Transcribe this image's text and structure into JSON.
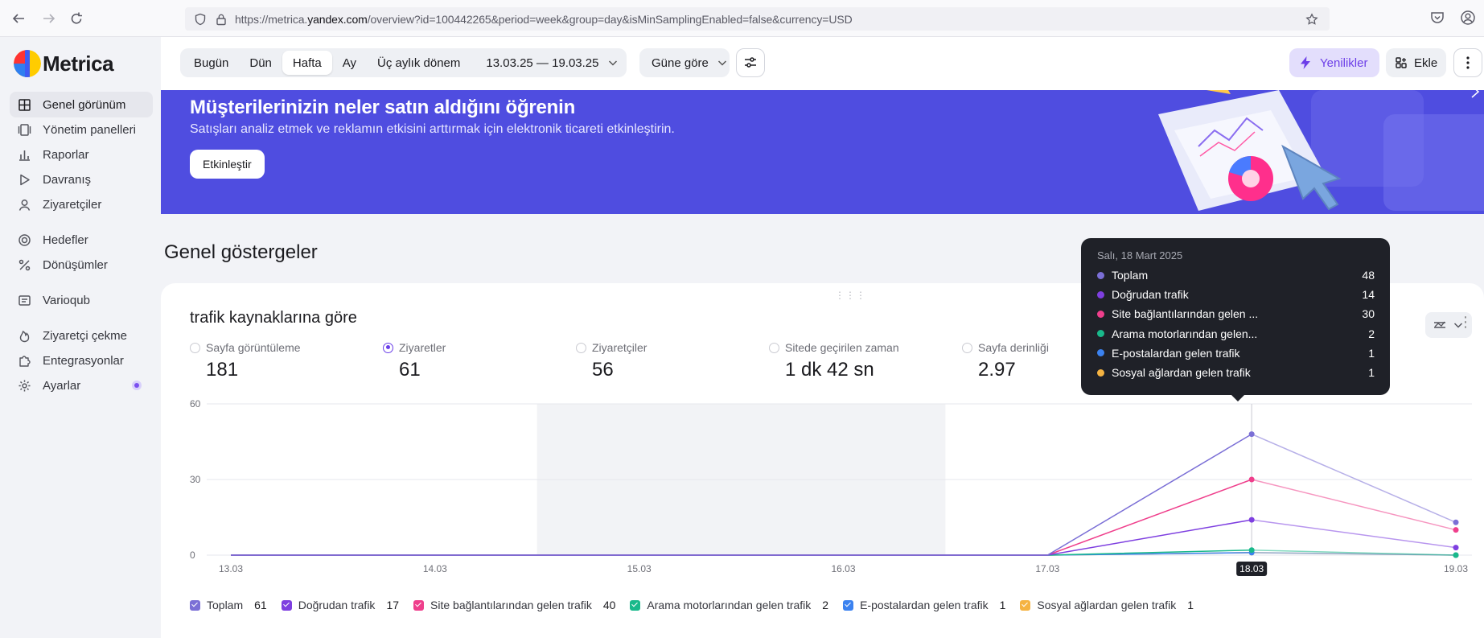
{
  "browser": {
    "url_prefix": "https://metrica.",
    "url_domain": "yandex.com",
    "url_suffix": "/overview?id=100442265&period=week&group=day&isMinSamplingEnabled=false&currency=USD"
  },
  "app": {
    "logo_text": "Metrica"
  },
  "sidebar": {
    "items": [
      {
        "label": "Genel görünüm",
        "icon": "grid-icon"
      },
      {
        "label": "Yönetim panelleri",
        "icon": "panels-icon"
      },
      {
        "label": "Raporlar",
        "icon": "bar-chart-icon"
      },
      {
        "label": "Davranış",
        "icon": "play-icon"
      },
      {
        "label": "Ziyaretçiler",
        "icon": "user-icon"
      },
      {
        "label": "Hedefler",
        "icon": "target-icon"
      },
      {
        "label": "Dönüşümler",
        "icon": "percent-icon"
      },
      {
        "label": "Varioqub",
        "icon": "flask-icon"
      },
      {
        "label": "Ziyaretçi çekme",
        "icon": "flame-icon"
      },
      {
        "label": "Entegrasyonlar",
        "icon": "puzzle-icon"
      },
      {
        "label": "Ayarlar",
        "icon": "gear-icon"
      }
    ]
  },
  "toolbar": {
    "periods": [
      "Bugün",
      "Dün",
      "Hafta",
      "Ay",
      "Üç aylık dönem"
    ],
    "active_period": "Hafta",
    "date_range": "13.03.25 — 19.03.25",
    "grouping": "Güne göre",
    "news_label": "Yenilikler",
    "add_label": "Ekle"
  },
  "banner": {
    "title": "Müşterilerinizin neler satın aldığını öğrenin",
    "subtitle": "Satışları analiz etmek ve reklamın etkisini arttırmak için elektronik ticareti etkinleştirin.",
    "button": "Etkinleştir"
  },
  "section": {
    "title": "Genel göstergeler"
  },
  "card": {
    "title": "trafik kaynaklarına göre",
    "metrics": [
      {
        "label": "Sayfa görüntüleme",
        "value": "181",
        "selected": false
      },
      {
        "label": "Ziyaretler",
        "value": "61",
        "selected": true
      },
      {
        "label": "Ziyaretçiler",
        "value": "56",
        "selected": false
      },
      {
        "label": "Sitede geçirilen zaman",
        "value": "1 dk 42 sn",
        "selected": false
      },
      {
        "label": "Sayfa derinliği",
        "value": "2.97",
        "selected": false
      }
    ],
    "legend": [
      {
        "name": "Toplam",
        "value": "61",
        "color": "#7b6fd6"
      },
      {
        "name": "Doğrudan trafik",
        "value": "17",
        "color": "#7e3fe0"
      },
      {
        "name": "Site bağlantılarından gelen trafik",
        "value": "40",
        "color": "#ef3f8c"
      },
      {
        "name": "Arama motorlarından gelen trafik",
        "value": "2",
        "color": "#19b98b"
      },
      {
        "name": "E-postalardan gelen trafik",
        "value": "1",
        "color": "#3b82f0"
      },
      {
        "name": "Sosyal ağlardan gelen trafik",
        "value": "1",
        "color": "#f5b342"
      }
    ]
  },
  "tooltip": {
    "date": "Salı, 18 Mart 2025",
    "rows": [
      {
        "name": "Toplam",
        "value": "48",
        "color": "#7b6fd6"
      },
      {
        "name": "Doğrudan trafik",
        "value": "14",
        "color": "#7e3fe0"
      },
      {
        "name": "Site bağlantılarından gelen ...",
        "value": "30",
        "color": "#ef3f8c"
      },
      {
        "name": "Arama motorlarından gelen...",
        "value": "2",
        "color": "#19b98b"
      },
      {
        "name": "E-postalardan gelen trafik",
        "value": "1",
        "color": "#3b82f0"
      },
      {
        "name": "Sosyal ağlardan gelen trafik",
        "value": "1",
        "color": "#f5b342"
      }
    ]
  },
  "chart_data": {
    "type": "line",
    "x": [
      "13.03",
      "14.03",
      "15.03",
      "16.03",
      "17.03",
      "18.03",
      "19.03"
    ],
    "ylim": [
      0,
      60
    ],
    "yticks": [
      "0",
      "30",
      "60"
    ],
    "highlighted_x": "18.03",
    "series": [
      {
        "name": "Toplam",
        "color": "#7b6fd6",
        "values": [
          0,
          0,
          0,
          0,
          0,
          48,
          13
        ]
      },
      {
        "name": "Doğrudan trafik",
        "color": "#7e3fe0",
        "values": [
          0,
          0,
          0,
          0,
          0,
          14,
          3
        ]
      },
      {
        "name": "Site bağlantılarından gelen trafik",
        "color": "#ef3f8c",
        "values": [
          0,
          0,
          0,
          0,
          0,
          30,
          10
        ]
      },
      {
        "name": "Arama motorlarından gelen trafik",
        "color": "#19b98b",
        "values": [
          0,
          0,
          0,
          0,
          0,
          2,
          0
        ]
      },
      {
        "name": "E-postalardan gelen trafik",
        "color": "#3b82f0",
        "values": [
          0,
          0,
          0,
          0,
          0,
          1,
          0
        ]
      },
      {
        "name": "Sosyal ağlardan gelen trafik",
        "color": "#f5b342",
        "values": [
          0,
          0,
          0,
          0,
          0,
          1,
          0
        ]
      }
    ]
  }
}
